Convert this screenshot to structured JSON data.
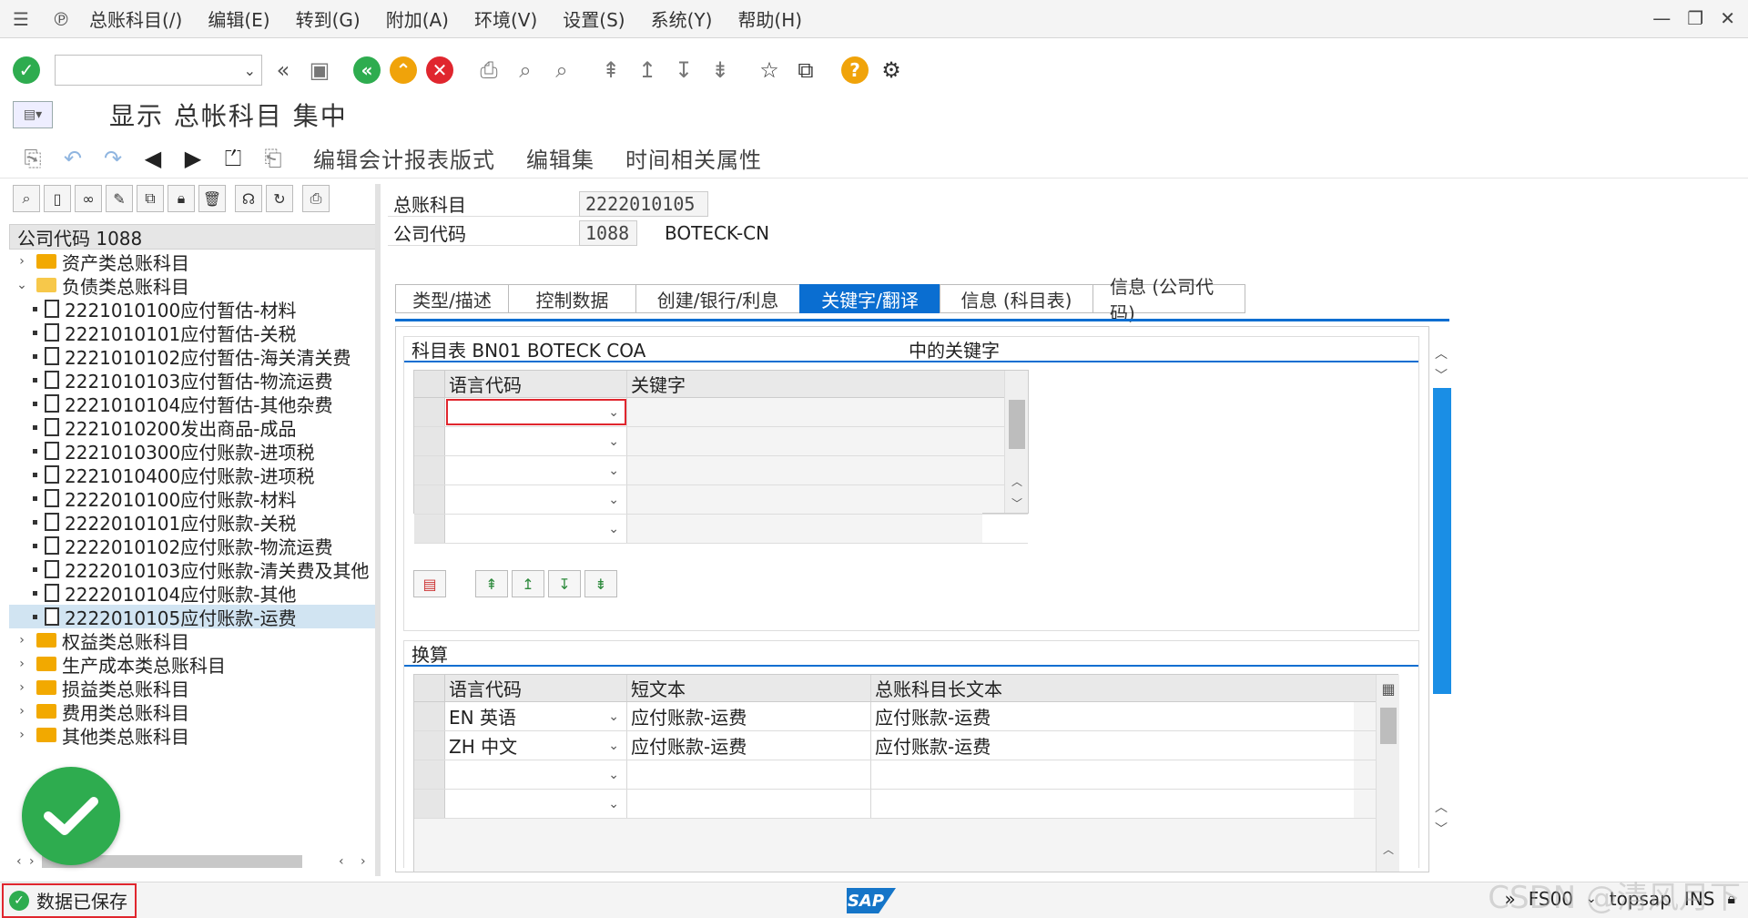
{
  "menubar": {
    "items": [
      "总账科目(/)",
      "编辑(E)",
      "转到(G)",
      "附加(A)",
      "环境(V)",
      "设置(S)",
      "系统(Y)",
      "帮助(H)"
    ]
  },
  "toolbar": {
    "command_value": ""
  },
  "title": {
    "text": "显示 总帐科目 集中"
  },
  "apptool": {
    "buttons": [
      "编辑会计报表版式",
      "编辑集",
      "时间相关属性"
    ]
  },
  "tree": {
    "header": "公司代码 1088",
    "nodes": [
      {
        "label": "资产类总账科目",
        "type": "folder",
        "expanded": false
      },
      {
        "label": "负债类总账科目",
        "type": "folder",
        "expanded": true
      },
      {
        "label": "2221010100应付暂估-材料",
        "type": "doc"
      },
      {
        "label": "2221010101应付暂估-关税",
        "type": "doc"
      },
      {
        "label": "2221010102应付暂估-海关清关费",
        "type": "doc"
      },
      {
        "label": "2221010103应付暂估-物流运费",
        "type": "doc"
      },
      {
        "label": "2221010104应付暂估-其他杂费",
        "type": "doc"
      },
      {
        "label": "2221010200发出商品-成品",
        "type": "doc"
      },
      {
        "label": "2221010300应付账款-进项税",
        "type": "doc"
      },
      {
        "label": "2221010400应付账款-进项税",
        "type": "doc"
      },
      {
        "label": "2222010100应付账款-材料",
        "type": "doc"
      },
      {
        "label": "2222010101应付账款-关税",
        "type": "doc"
      },
      {
        "label": "2222010102应付账款-物流运费",
        "type": "doc"
      },
      {
        "label": "2222010103应付账款-清关费及其他",
        "type": "doc"
      },
      {
        "label": "2222010104应付账款-其他",
        "type": "doc"
      },
      {
        "label": "2222010105应付账款-运费",
        "type": "doc",
        "selected": true
      },
      {
        "label": "权益类总账科目",
        "type": "folder",
        "expanded": false
      },
      {
        "label": "生产成本类总账科目",
        "type": "folder",
        "expanded": false
      },
      {
        "label": "损益类总账科目",
        "type": "folder",
        "expanded": false
      },
      {
        "label": "费用类总账科目",
        "type": "folder",
        "expanded": false
      },
      {
        "label": "其他类总账科目",
        "type": "folder",
        "expanded": false
      }
    ]
  },
  "header_fields": {
    "gl_account_label": "总账科目",
    "gl_account_value": "2222010105",
    "company_code_label": "公司代码",
    "company_code_value": "1088",
    "company_name": "BOTECK-CN"
  },
  "tabs": [
    {
      "label": "类型/描述",
      "active": false
    },
    {
      "label": "控制数据",
      "active": false
    },
    {
      "label": "创建/银行/利息",
      "active": false
    },
    {
      "label": "关键字/翻译",
      "active": true
    },
    {
      "label": "信息 (科目表)",
      "active": false
    },
    {
      "label": "信息 (公司代码)",
      "active": false
    }
  ],
  "keywords_group": {
    "title_left": "科目表 BN01 BOTECK COA",
    "title_right": "中的关键字",
    "col_lang": "语言代码",
    "col_keyword": "关键字"
  },
  "translation_group": {
    "title": "换算",
    "col_lang": "语言代码",
    "col_short": "短文本",
    "col_long": "总账科目长文本",
    "rows": [
      {
        "lang": "EN 英语",
        "short": "应付账款-运费",
        "long": "应付账款-运费"
      },
      {
        "lang": "ZH 中文",
        "short": "应付账款-运费",
        "long": "应付账款-运费"
      }
    ]
  },
  "statusbar": {
    "message": "数据已保存",
    "logo": "SAP",
    "transaction": "FS00",
    "server": "topsap",
    "mode": "INS"
  },
  "watermark": "CSDN @清风月下",
  "colors": {
    "accent": "#0a6ed1",
    "success": "#2eac4f",
    "error_border": "#e0262e"
  }
}
